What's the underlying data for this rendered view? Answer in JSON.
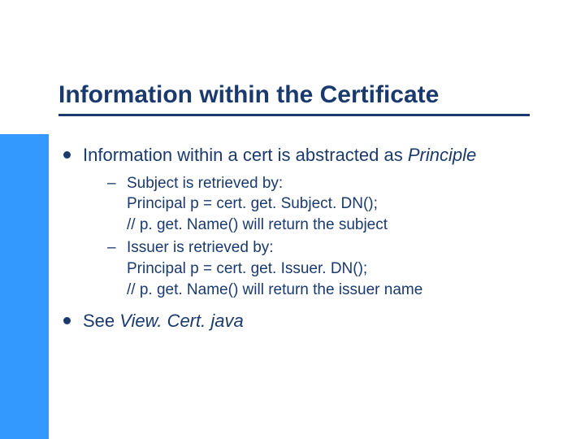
{
  "slide": {
    "title": "Information within the Certificate",
    "bullet1_prefix": "Information within a cert is abstracted as ",
    "bullet1_italic": "Principle",
    "sub1_line1": "Subject is retrieved by:",
    "sub1_line2": "Principal p = cert. get. Subject. DN();",
    "sub1_line3": "// p. get. Name() will return the subject",
    "sub2_line1": "Issuer is retrieved by:",
    "sub2_line2": "Principal p = cert. get. Issuer. DN();",
    "sub2_line3": "// p. get. Name() will return the issuer name",
    "bullet2_prefix": "See ",
    "bullet2_italic": "View. Cert. java"
  }
}
